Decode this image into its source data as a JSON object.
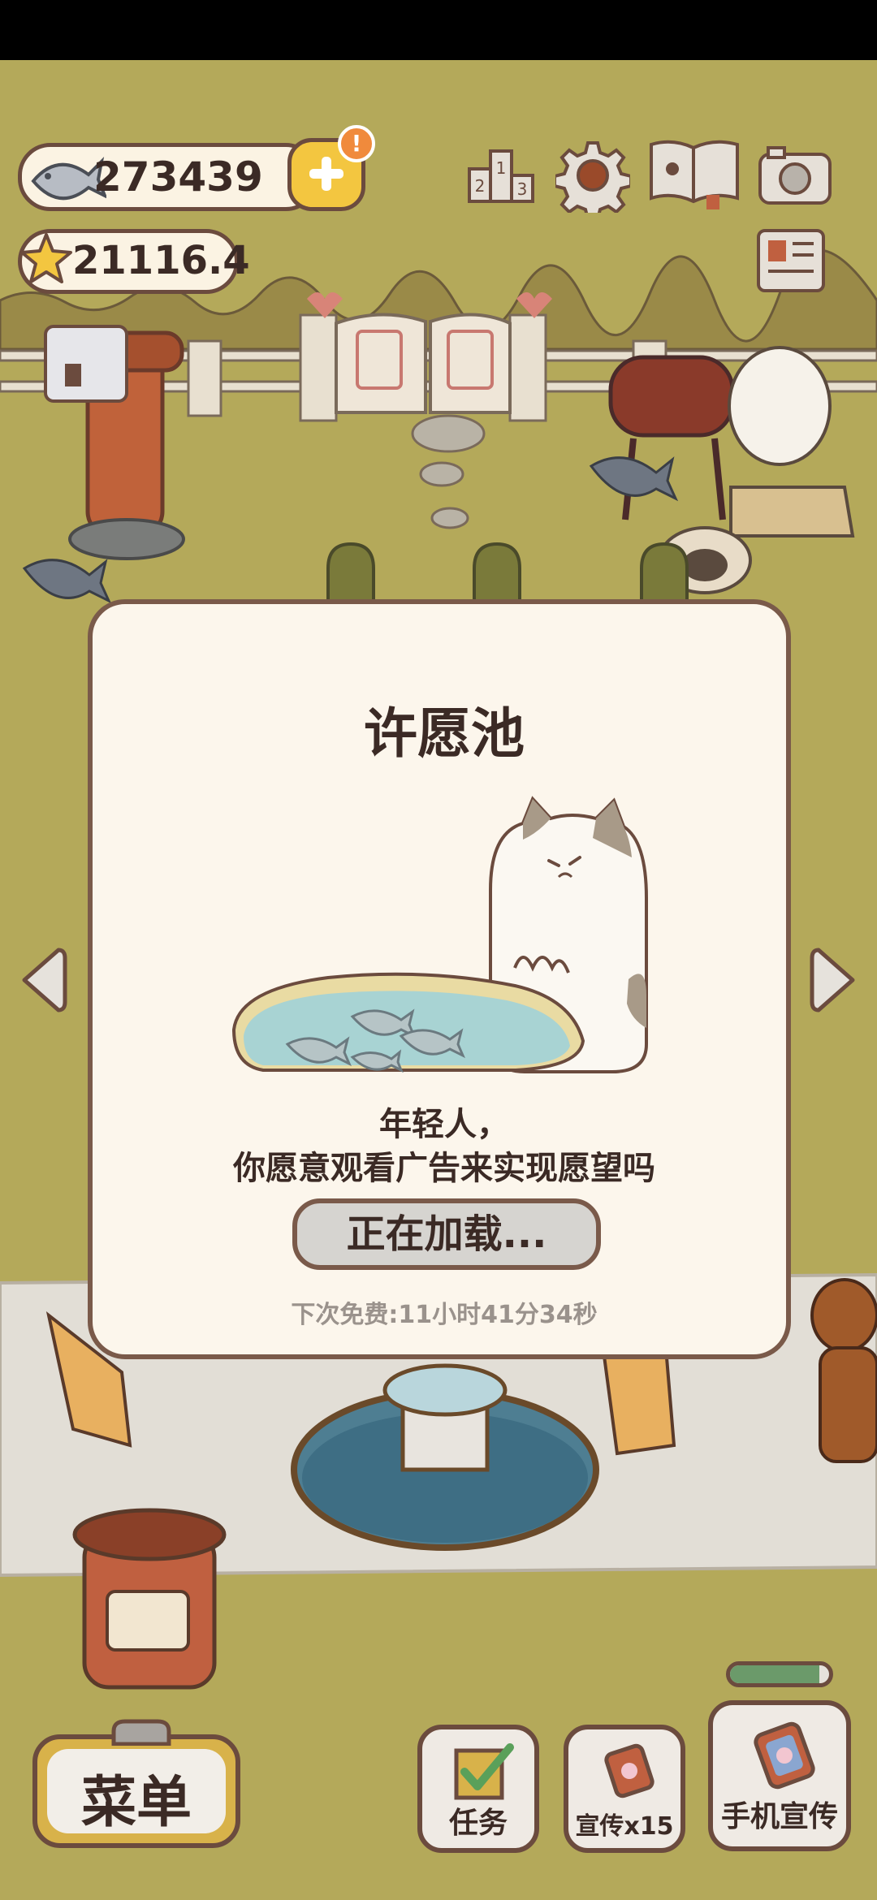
{
  "resources": {
    "fish_count": "273439",
    "star_count": "21116.4",
    "notification_badge": "!"
  },
  "top_icons": [
    "ranking-icon",
    "settings-gear-icon",
    "catalog-book-icon",
    "camera-icon",
    "newspaper-icon"
  ],
  "dialog": {
    "title": "许愿池",
    "message_line1": "年轻人，",
    "message_line2": "你愿意观看广告来实现愿望吗",
    "button_label": "正在加载...",
    "next_free": "下次免费:11小时41分34秒"
  },
  "bottom_bar": {
    "menu_label": "菜单",
    "tasks_label": "任务",
    "promote_label": "宣传x15",
    "phone_promote_label": "手机宣传"
  },
  "colors": {
    "background_grass": "#b4a95a",
    "dialog_bg": "#fcf6ec",
    "outline_brown": "#6b4b3e",
    "plus_button_yellow": "#f3c640",
    "badge_orange": "#f08a3c",
    "progress_green": "#6b9a6a"
  },
  "progress_bar_fraction": 0.9
}
